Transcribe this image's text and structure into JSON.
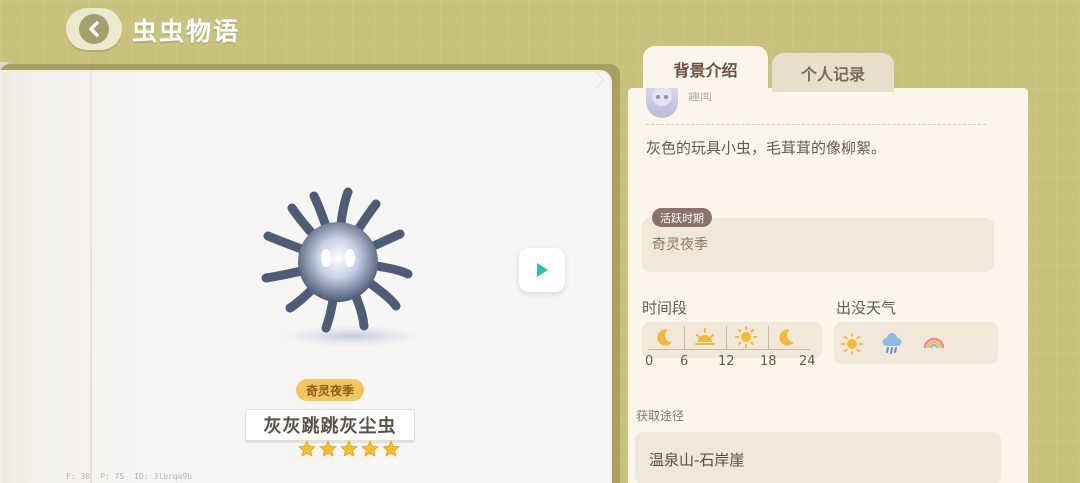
{
  "header": {
    "title": "虫虫物语",
    "back_icon": "chevron-left-icon"
  },
  "book": {
    "season_badge": "奇灵夜季",
    "bug_name": "灰灰跳跳灰尘虫",
    "rating": 5,
    "debug": {
      "f": "F: 30",
      "p": "P: 75",
      "id": "ID: 3lbrqa9b"
    }
  },
  "tabs": [
    {
      "label": "背景介绍",
      "active": true
    },
    {
      "label": "个人记录",
      "active": false
    }
  ],
  "panel": {
    "top_partial_text": "趣闻",
    "description": "灰色的玩具小虫，毛茸茸的像柳絮。",
    "active_period": {
      "label": "活跃时期",
      "value": "奇灵夜季"
    },
    "time_section": {
      "title": "时间段",
      "ticks": [
        "0",
        "6",
        "12",
        "18",
        "24"
      ],
      "icons": [
        "moon-icon",
        "sunrise-icon",
        "sun-icon",
        "moon-icon"
      ]
    },
    "weather_section": {
      "title": "出没天气",
      "icons": [
        "sun-icon",
        "rain-icon",
        "rainbow-icon"
      ]
    },
    "source": {
      "title": "获取途径",
      "value": "温泉山-石岸崖"
    }
  },
  "colors": {
    "background": "#c9c27c",
    "panel": "#fcf5ec",
    "badge": "#f3c75e",
    "accent_teal": "#2fbfb0"
  }
}
